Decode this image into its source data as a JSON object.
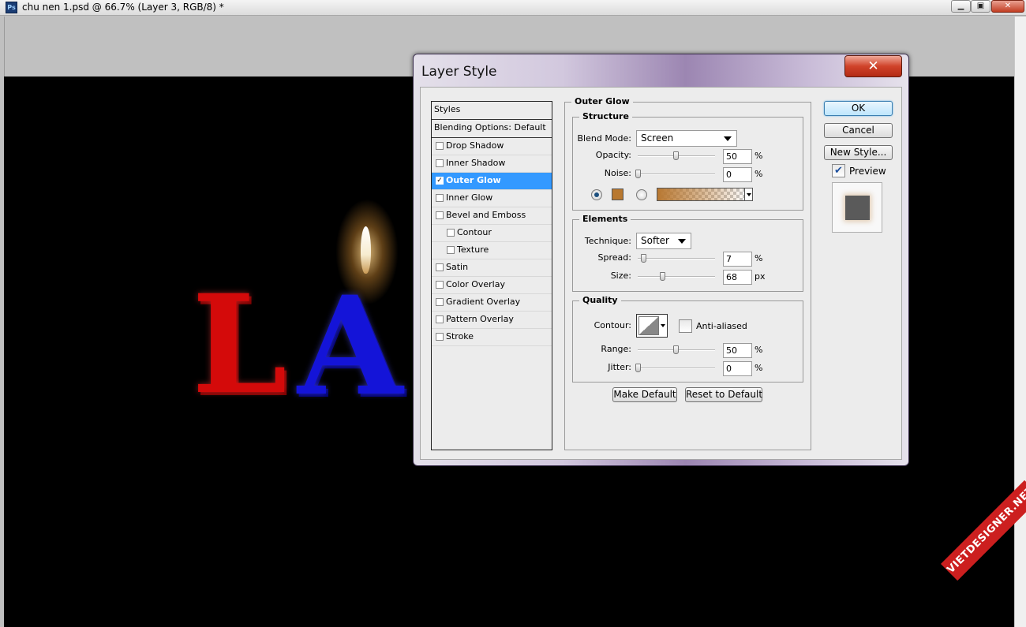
{
  "document": {
    "app_icon": "Ps",
    "title": "chu nen 1.psd @ 66.7% (Layer 3, RGB/8) *",
    "window_controls": {
      "minimize": "▁",
      "restore": "▣",
      "close": "✕"
    }
  },
  "canvas": {
    "letters": [
      "L",
      "A"
    ],
    "watermark": "VIETDESIGNER.NET"
  },
  "dialog": {
    "title": "Layer Style",
    "close_label": "✕",
    "styles_header": "Styles",
    "blending_options": "Blending Options: Default",
    "styles": [
      {
        "label": "Drop Shadow",
        "checked": false,
        "selected": false,
        "sub": false
      },
      {
        "label": "Inner Shadow",
        "checked": false,
        "selected": false,
        "sub": false
      },
      {
        "label": "Outer Glow",
        "checked": true,
        "selected": true,
        "sub": false
      },
      {
        "label": "Inner Glow",
        "checked": false,
        "selected": false,
        "sub": false
      },
      {
        "label": "Bevel and Emboss",
        "checked": false,
        "selected": false,
        "sub": false
      },
      {
        "label": "Contour",
        "checked": false,
        "selected": false,
        "sub": true
      },
      {
        "label": "Texture",
        "checked": false,
        "selected": false,
        "sub": true
      },
      {
        "label": "Satin",
        "checked": false,
        "selected": false,
        "sub": false
      },
      {
        "label": "Color Overlay",
        "checked": false,
        "selected": false,
        "sub": false
      },
      {
        "label": "Gradient Overlay",
        "checked": false,
        "selected": false,
        "sub": false
      },
      {
        "label": "Pattern Overlay",
        "checked": false,
        "selected": false,
        "sub": false
      },
      {
        "label": "Stroke",
        "checked": false,
        "selected": false,
        "sub": false
      }
    ],
    "outer_glow": {
      "title": "Outer Glow",
      "structure": {
        "title": "Structure",
        "blend_mode_label": "Blend Mode:",
        "blend_mode": "Screen",
        "opacity_label": "Opacity:",
        "opacity": "50",
        "noise_label": "Noise:",
        "noise": "0",
        "percent": "%",
        "glow_color": "#b8782f"
      },
      "elements": {
        "title": "Elements",
        "technique_label": "Technique:",
        "technique": "Softer",
        "spread_label": "Spread:",
        "spread": "7",
        "size_label": "Size:",
        "size": "68",
        "percent": "%",
        "px": "px"
      },
      "quality": {
        "title": "Quality",
        "contour_label": "Contour:",
        "anti_aliased_label": "Anti-aliased",
        "anti_aliased": false,
        "range_label": "Range:",
        "range": "50",
        "jitter_label": "Jitter:",
        "jitter": "0",
        "percent": "%"
      },
      "make_default": "Make Default",
      "reset_default": "Reset to Default"
    },
    "ok_label": "OK",
    "cancel_label": "Cancel",
    "new_style_label": "New Style...",
    "preview_label": "Preview",
    "preview_checked": true
  }
}
